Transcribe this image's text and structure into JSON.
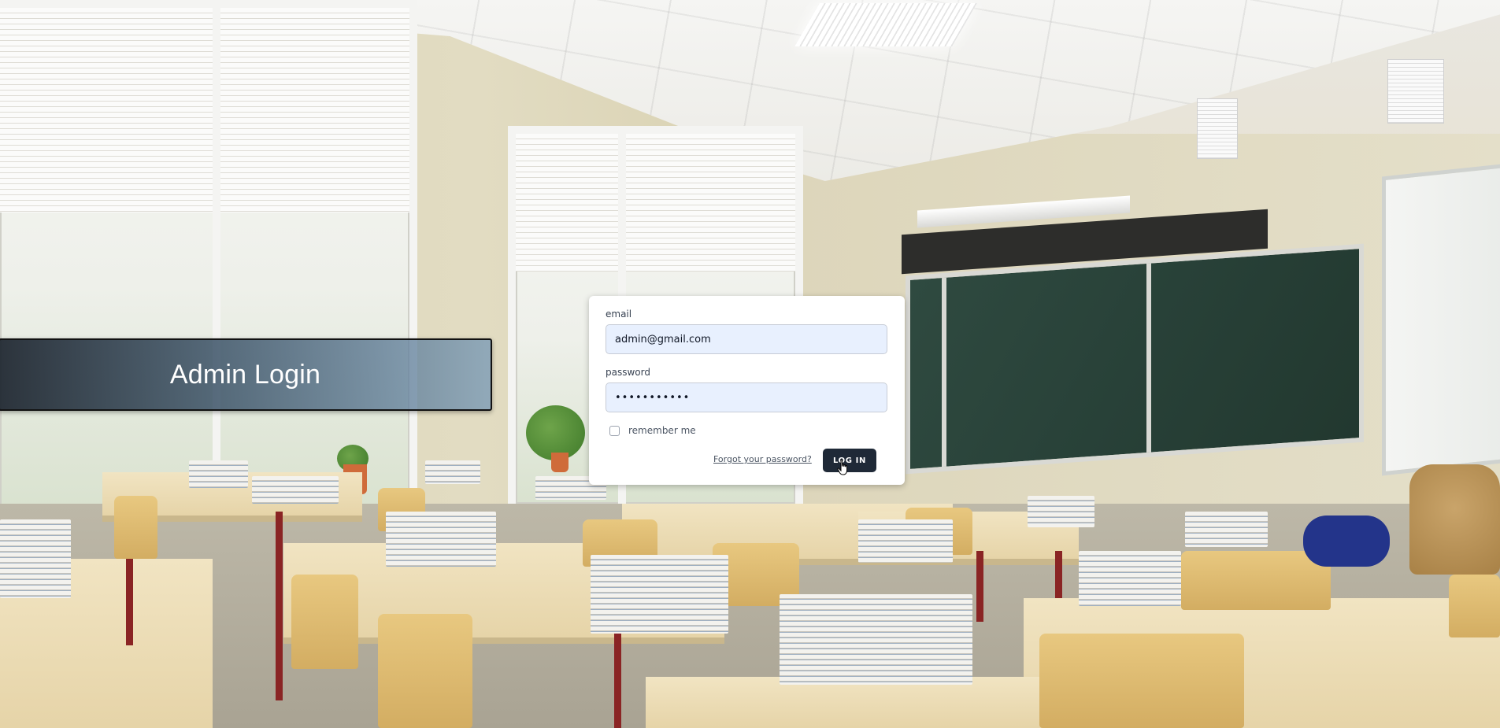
{
  "banner": {
    "title": "Admin Login"
  },
  "login_form": {
    "email": {
      "label": "email",
      "value": "admin@gmail.com"
    },
    "password": {
      "label": "password",
      "value": "•••••••••••"
    },
    "remember": {
      "label": "remember me",
      "checked": false
    },
    "forgot_link": "Forgot your password?",
    "submit_label": "LOG IN"
  },
  "icons": {
    "cursor": "hand-pointer-icon"
  },
  "colors": {
    "button_bg": "#1f2937",
    "input_bg": "#e8f0fe",
    "card_bg": "#ffffff"
  }
}
